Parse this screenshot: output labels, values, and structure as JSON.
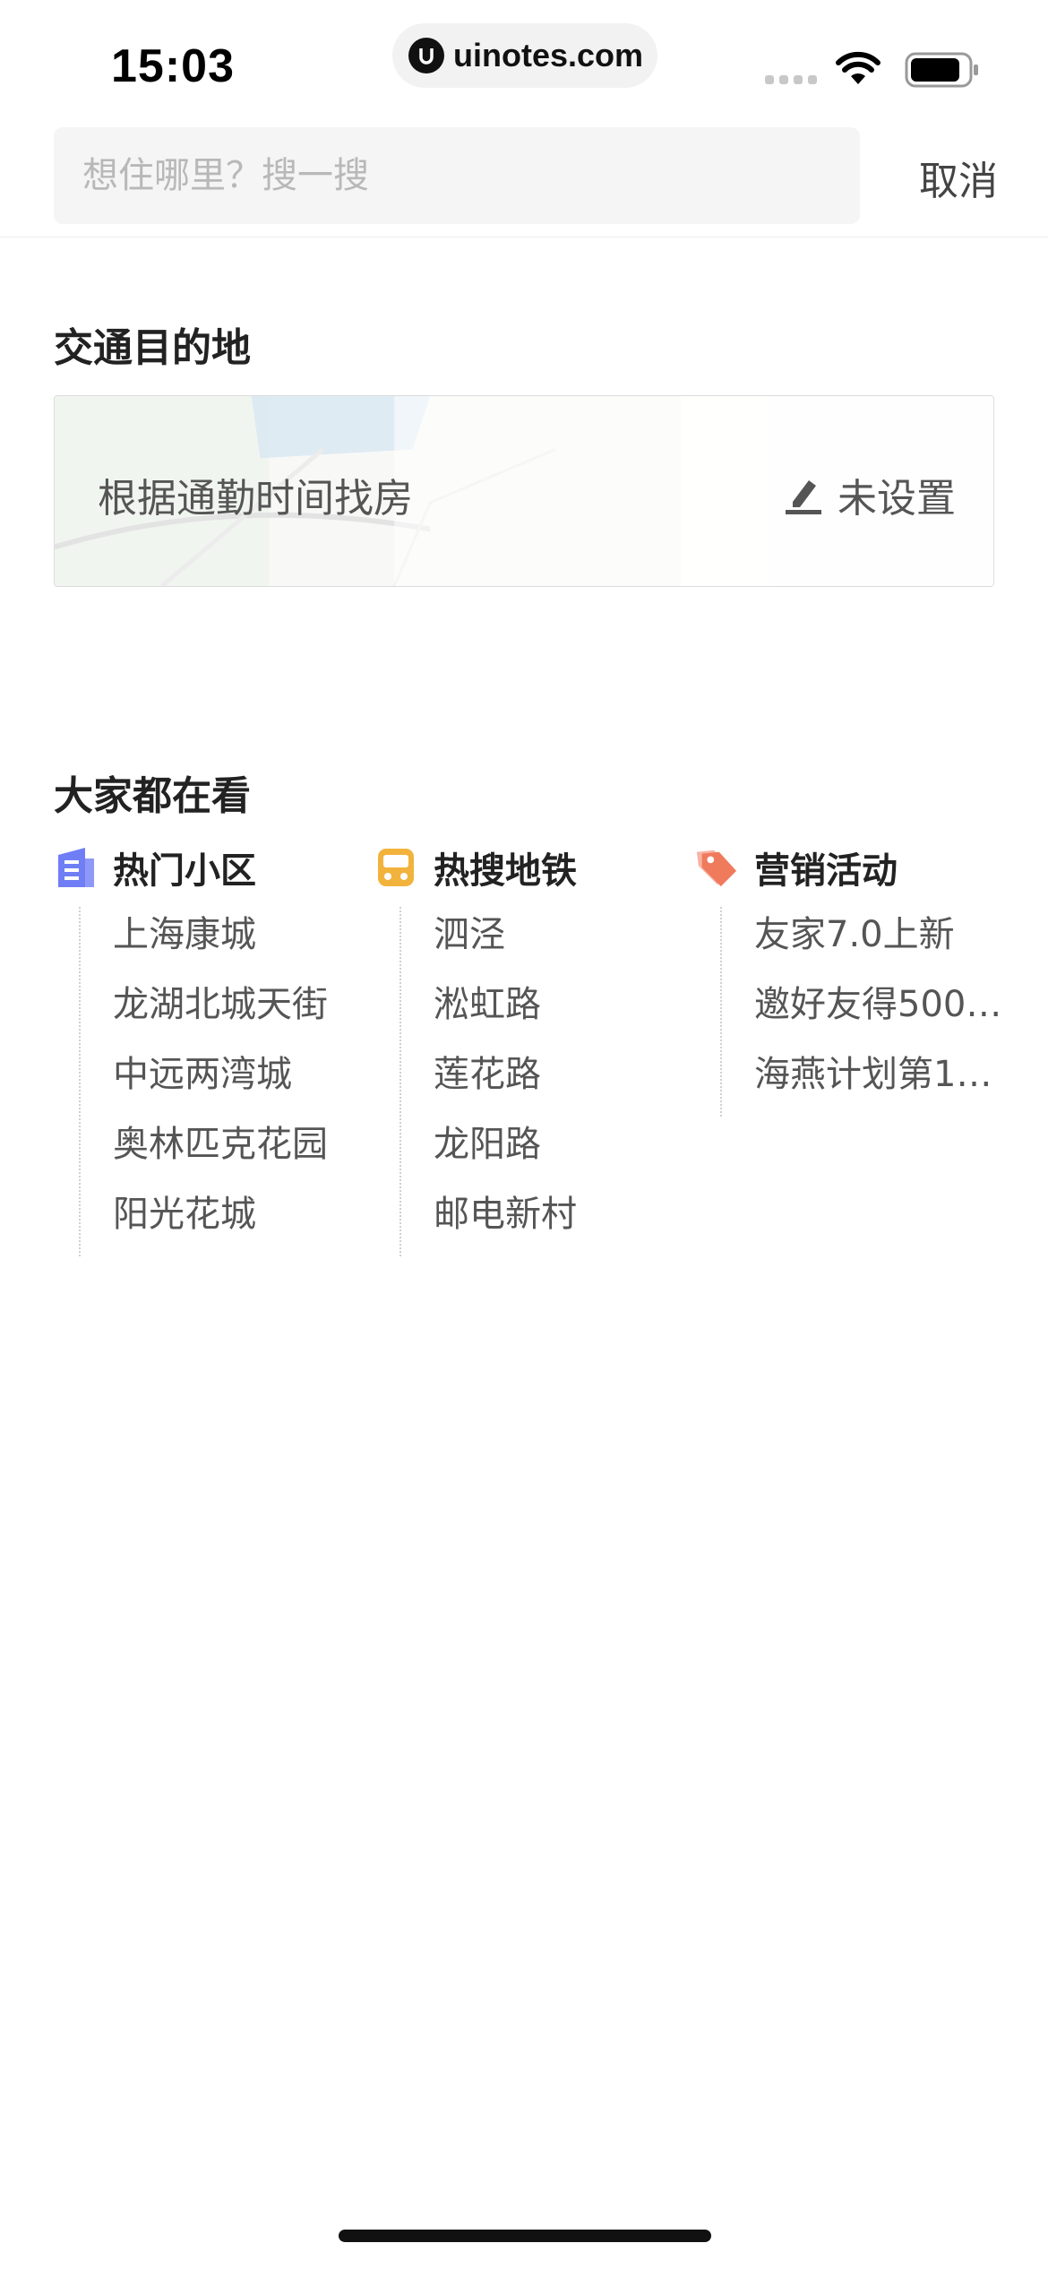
{
  "status_bar": {
    "time": "15:03",
    "url": "uinotes.com"
  },
  "search": {
    "placeholder": "想住哪里？搜一搜",
    "cancel_label": "取消"
  },
  "commute": {
    "section_title": "交通目的地",
    "label": "根据通勤时间找房",
    "action_label": "未设置"
  },
  "popular": {
    "section_title": "大家都在看",
    "columns": [
      {
        "title": "热门小区",
        "icon": "building-icon",
        "color": "#6f7ef5",
        "items": [
          "上海康城",
          "龙湖北城天街",
          "中远两湾城",
          "奥林匹克花园",
          "阳光花城"
        ]
      },
      {
        "title": "热搜地铁",
        "icon": "metro-icon",
        "color": "#f2b33d",
        "items": [
          "泗泾",
          "淞虹路",
          "莲花路",
          "龙阳路",
          "邮电新村"
        ]
      },
      {
        "title": "营销活动",
        "icon": "tag-icon",
        "color": "#f07a5c",
        "items": [
          "友家7.0上新",
          "邀好友得500…",
          "海燕计划第1…"
        ]
      }
    ]
  }
}
